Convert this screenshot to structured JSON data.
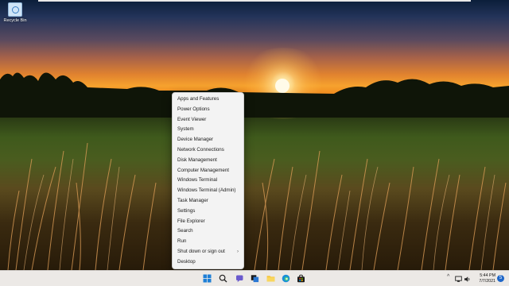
{
  "desktop": {
    "recycle_bin_label": "Recycle Bin"
  },
  "context_menu": {
    "items": [
      {
        "label": "Apps and Features"
      },
      {
        "label": "Power Options"
      },
      {
        "label": "Event Viewer"
      },
      {
        "label": "System"
      },
      {
        "label": "Device Manager"
      },
      {
        "label": "Network Connections"
      },
      {
        "label": "Disk Management"
      },
      {
        "label": "Computer Management"
      },
      {
        "label": "Windows Terminal"
      },
      {
        "label": "Windows Terminal (Admin)"
      },
      {
        "label": "Task Manager"
      },
      {
        "label": "Settings"
      },
      {
        "label": "File Explorer"
      },
      {
        "label": "Search"
      },
      {
        "label": "Run"
      },
      {
        "label": "Shut down or sign out",
        "submenu_arrow": "›"
      },
      {
        "label": "Desktop"
      }
    ]
  },
  "taskbar": {
    "icons": [
      "start-icon",
      "search-icon",
      "chat-icon",
      "task-view-icon",
      "file-explorer-icon",
      "edge-icon",
      "store-icon"
    ],
    "tray": {
      "chevron": "^",
      "time": "5:44 PM",
      "date": "7/7/2021",
      "notification_count": "5"
    }
  },
  "colors": {
    "menu_bg": "#f3f3f3",
    "taskbar_bg": "#ece9e6",
    "accent": "#1e66c8"
  }
}
